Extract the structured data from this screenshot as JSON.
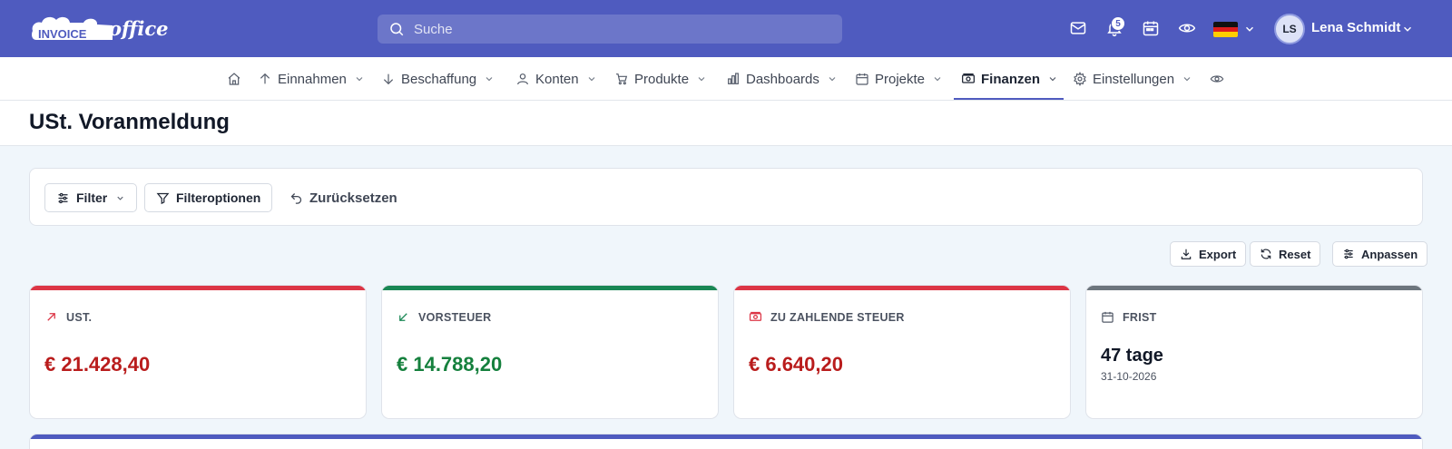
{
  "brand": {
    "logo_text_1": "INVOICE",
    "logo_text_2": "office"
  },
  "search": {
    "placeholder": "Suche"
  },
  "topbar": {
    "notifications_count": "5",
    "user_initials": "LS",
    "user_name": "Lena Schmidt"
  },
  "nav": {
    "items": [
      {
        "label": "Einnahmen"
      },
      {
        "label": "Beschaffung"
      },
      {
        "label": "Konten"
      },
      {
        "label": "Produkte"
      },
      {
        "label": "Dashboards"
      },
      {
        "label": "Projekte"
      },
      {
        "label": "Finanzen"
      },
      {
        "label": "Einstellungen"
      }
    ],
    "active": "Finanzen"
  },
  "page": {
    "title": "USt. Voranmeldung"
  },
  "filters": {
    "filter_label": "Filter",
    "options_label": "Filteroptionen",
    "reset_label": "Zurücksetzen"
  },
  "actions": {
    "export_label": "Export",
    "reset_label": "Reset",
    "customize_label": "Anpassen"
  },
  "kpis": [
    {
      "label": "UST.",
      "value": "€ 21.428,40",
      "color": "#b91c1c",
      "bar_color": "#dc3545",
      "icon": "arrow-up-right-icon"
    },
    {
      "label": "VORSTEUER",
      "value": "€ 14.788,20",
      "color": "#15803d",
      "bar_color": "#198754",
      "icon": "arrow-down-left-icon"
    },
    {
      "label": "ZU ZAHLENDE STEUER",
      "value": "€ 6.640,20",
      "color": "#b91c1c",
      "bar_color": "#dc3545",
      "icon": "money-icon"
    },
    {
      "label": "FRIST",
      "value": "47 tage",
      "date": "31-10-2026",
      "color": "#111827",
      "bar_color": "#6c757d",
      "icon": "calendar-icon"
    }
  ],
  "colors": {
    "primary": "#4f5bbf",
    "background": "#f0f6fb"
  }
}
